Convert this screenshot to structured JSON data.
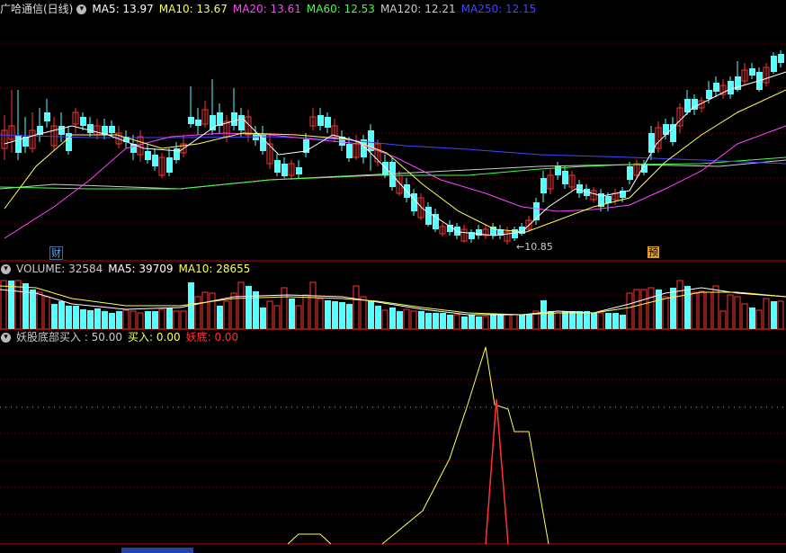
{
  "header": {
    "title": "广哈通信(日线)",
    "ma": [
      {
        "label": "MA5: 13.97",
        "color": "#ffffff"
      },
      {
        "label": "MA10: 13.67",
        "color": "#ffff55"
      },
      {
        "label": "MA20: 13.61",
        "color": "#ff44ff"
      },
      {
        "label": "MA60: 12.53",
        "color": "#44ff44"
      },
      {
        "label": "MA120: 12.21",
        "color": "#cccccc"
      },
      {
        "label": "MA250: 12.15",
        "color": "#4444ff"
      }
    ]
  },
  "price_panel": {
    "min_label": "←10.85",
    "tag_cai": "财",
    "tag_yu": "预"
  },
  "volume_panel": {
    "items": [
      {
        "label": "VOLUME: 32584",
        "color": "#cccccc"
      },
      {
        "label": "MA5: 39709",
        "color": "#ffffff"
      },
      {
        "label": "MA10: 28655",
        "color": "#ffff55"
      }
    ]
  },
  "indicator_panel": {
    "items": [
      {
        "label": "妖股底部买入 : 50.00",
        "color": "#cccccc"
      },
      {
        "label": "买入: 0.00",
        "color": "#ffff55"
      },
      {
        "label": "妖底: 0.00",
        "color": "#ff3333"
      }
    ]
  },
  "colors": {
    "up": "#ff3333",
    "down": "#54ffff",
    "grid": "#8b0000",
    "border": "#c00000",
    "ma5": "#ffffff",
    "ma10": "#ffff55",
    "ma20": "#ff44ff",
    "ma60": "#44ff44",
    "ma120": "#cccccc",
    "ma250": "#4444ff"
  }
}
